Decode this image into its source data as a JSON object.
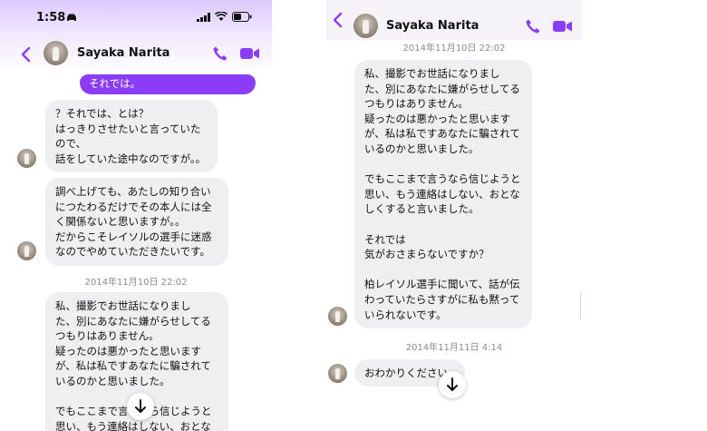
{
  "left_panel": {
    "status_time": "1:58",
    "contact_name": "Sayaka Narita",
    "outgoing_partial": "それでは。",
    "messages": [
      "？それでは、とは？\nはっきりさせたいと言っていた\nので、\n話をしていた途中なのですが。。",
      "調べ上げても、あたしの知り合い\nにつたわるだけでその本人には全\nく関係ないと思いますが。。\nだからこそレイソルの選手に迷惑\nなのでやめていただきたいです。",
      "私、撮影でお世話になりまし\nた、別にあなたに嫌がらせしてる\nつもりはありません。\n疑ったのは悪かったと思います\nが、私は私ですあなたに騙されて\nいるのかと思いました。\n\nでもここまで言うなら信じようと\n思い、もう連絡はしない、おとな"
    ],
    "timestamp": "2014年11月10日 22:02"
  },
  "right_panel": {
    "contact_name": "Sayaka Narita",
    "timestamp_top": "2014年11月10日 22:02",
    "message_long": "私、撮影でお世話になりまし\nた、別にあなたに嫌がらせしてる\nつもりはありません。\n疑ったのは悪かったと思います\nが、私は私ですあなたに騙されて\nいるのかと思いました。\n\nでもここまで言うなら信じようと\n思い、もう連絡はしない、おとな\nしくすると言いました。\n\nそれでは\n気がおさまらないですか？\n\n柏レイソル選手に聞いて、話が伝\nわっていたらさすがに私も黙って\nいられないです。",
    "timestamp_bottom": "2014年11月11日 4:14",
    "message_short": "おわかりください"
  },
  "colors": {
    "accent": "#8b3cf6",
    "bubble": "#efeff2",
    "timestamp": "#8b8b93"
  },
  "icons": [
    "back-chevron-icon",
    "phone-icon",
    "video-camera-icon",
    "scroll-down-arrow-icon",
    "car-icon",
    "signal-icon",
    "wifi-icon",
    "battery-icon"
  ]
}
